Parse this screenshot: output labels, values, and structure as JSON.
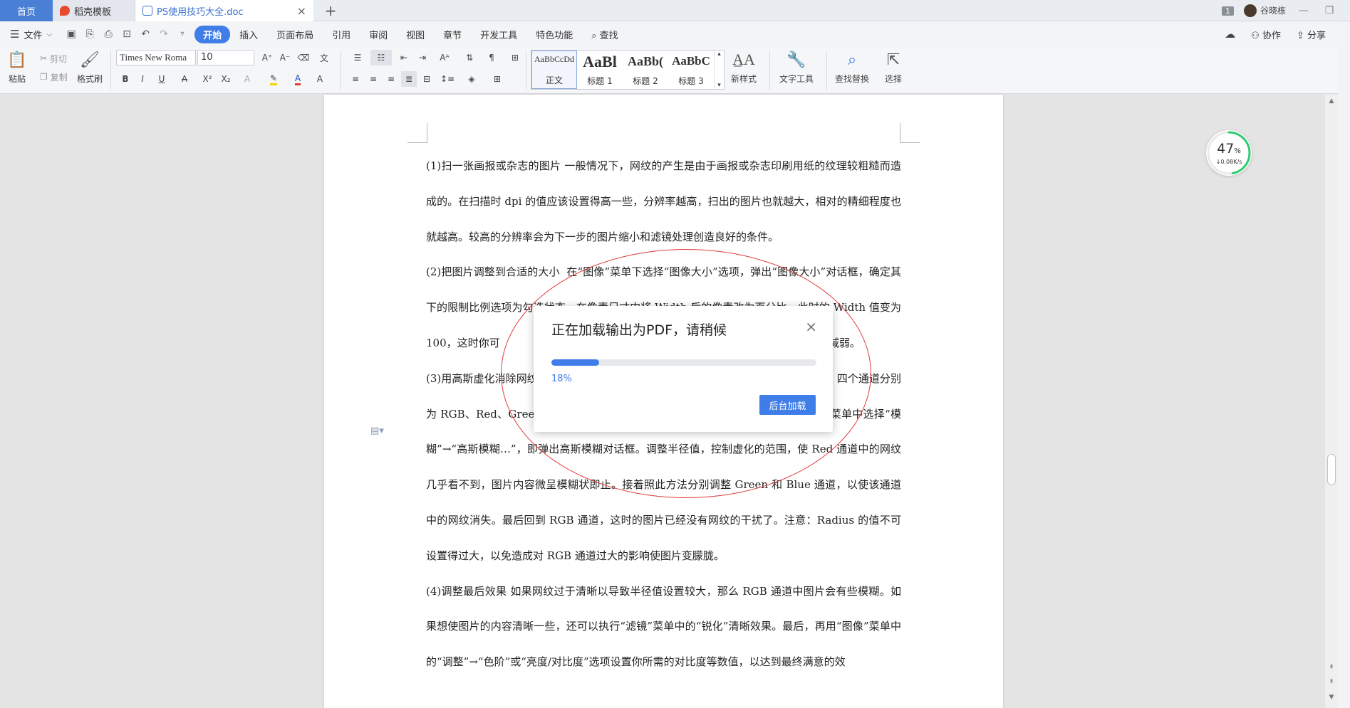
{
  "tabs": {
    "home": "首页",
    "template": "稻壳模板",
    "document": "PS使用技巧大全.doc",
    "new_tab": "+"
  },
  "titlebar": {
    "window_count": "1",
    "user_name": "谷晓栋",
    "minimize": "—",
    "restore": "❐"
  },
  "menu": {
    "file": "文件",
    "items": [
      "开始",
      "插入",
      "页面布局",
      "引用",
      "审阅",
      "视图",
      "章节",
      "开发工具",
      "特色功能",
      "查找"
    ],
    "active_index": 0,
    "collaborate": "协作",
    "share": "分享"
  },
  "ribbon": {
    "paste": "粘贴",
    "cut": "剪切",
    "copy": "复制",
    "format_painter": "格式刷",
    "font_name": "Times New Roma",
    "font_size": "10",
    "styles": [
      {
        "sample": "AaBbCcDd",
        "name": "正文"
      },
      {
        "sample": "AaBl",
        "name": "标题 1"
      },
      {
        "sample": "AaBb(",
        "name": "标题 2"
      },
      {
        "sample": "AaBbC",
        "name": "标题 3"
      }
    ],
    "new_style": "新样式",
    "text_tools": "文字工具",
    "find_replace": "查找替换",
    "select": "选择"
  },
  "document": {
    "paragraphs": [
      "(1)扫一张画报或杂志的图片  一般情况下，网纹的产生是由于画报或杂志印刷用纸的纹理较粗糙而造成的。在扫描时 dpi 的值应该设置得高一些，分辨率越高，扫出的图片也就越大，相对的精细程度也就越高。较高的分辨率会为下一步的图片缩小和滤镜处理创造良好的条件。",
      "(2)把图片调整到合适的大小  在“图像”菜单下选择“图像大小”选项，弹出“图像大小”对话框，确定其下的限制比例选项为勾选状态。在像素尺寸中将 Width 后的像素改为百分比，此时的 Width 值变为 100，这时你可                                                                                 情况已稍稍减弱。",
      "(3)用高斯虚化消除网纹                                                                                       四个通道分别为 RGB、Red、Green 和 Blue。选择 Red 通道，图片显示为黑白效果。在“滤镜”菜单中选择“模糊”→“高斯模糊…”，即弹出高斯模糊对话框。调整半径值，控制虚化的范围，使 Red 通道中的网纹几乎看不到，图片内容微呈模糊状即止。接着照此方法分别调整 Green 和 Blue 通道，以使该通道中的网纹消失。最后回到 RGB 通道，这时的图片已经没有网纹的干扰了。注意：Radius 的值不可设置得过大，以免造成对 RGB 通道过大的影响使图片变朦胧。",
      "(4)调整最后效果  如果网纹过于清晰以导致半径值设置较大，那么 RGB 通道中图片会有些模糊。如果想使图片的内容清晰一些，还可以执行“滤镜”菜单中的“锐化”清晰效果。最后，再用“图像”菜单中的“调整”→“色阶”或“亮度/对比度”选项设置你所需的对比度等数值，以达到最终满意的效"
    ]
  },
  "gauge": {
    "percent": "47",
    "percent_unit": "%",
    "speed": "↓0.08K/s",
    "level": 0.47
  },
  "dialog": {
    "title": "正在加载输出为PDF，请稍候",
    "progress_label": "18%",
    "progress": 0.18,
    "background_button": "后台加载"
  },
  "colors": {
    "accent": "#3f7de8",
    "annotation": "#e03a3a",
    "gauge_ring": "#2ecc71"
  }
}
